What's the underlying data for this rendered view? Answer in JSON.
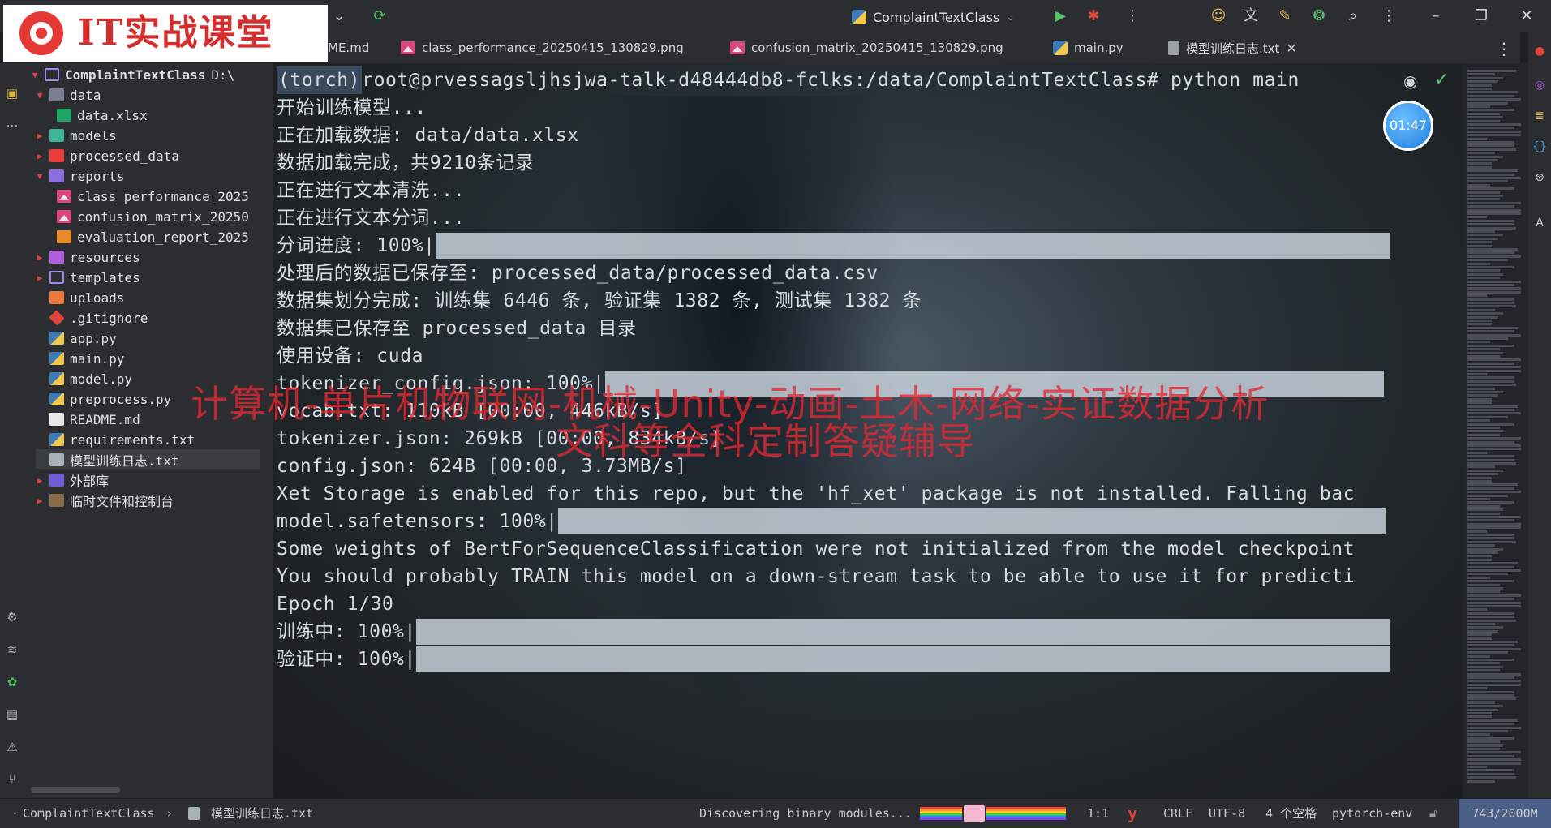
{
  "brand": {
    "text": "IT实战课堂"
  },
  "titlebar": {
    "project_name": "ComplaintTextClass"
  },
  "tabs": [
    {
      "label": "README.md",
      "visible_label": "ME.md",
      "icon": "markdown-icon"
    },
    {
      "label": "class_performance_20250415_130829.png",
      "icon": "image-icon"
    },
    {
      "label": "confusion_matrix_20250415_130829.png",
      "icon": "image-icon"
    },
    {
      "label": "main.py",
      "icon": "python-icon"
    },
    {
      "label": "模型训练日志.txt",
      "icon": "text-file-icon",
      "active": true
    }
  ],
  "project_tree": {
    "root_name": "ComplaintTextClass",
    "root_path": "D:\\",
    "items": [
      {
        "label": "data",
        "type": "folder"
      },
      {
        "label": "data.xlsx",
        "type": "xlsx"
      },
      {
        "label": "models",
        "type": "folder"
      },
      {
        "label": "processed_data",
        "type": "folder"
      },
      {
        "label": "reports",
        "type": "folder"
      },
      {
        "label": "class_performance_2025",
        "type": "image"
      },
      {
        "label": "confusion_matrix_20250",
        "type": "image"
      },
      {
        "label": "evaluation_report_2025",
        "type": "html"
      },
      {
        "label": "resources",
        "type": "folder"
      },
      {
        "label": "templates",
        "type": "folder"
      },
      {
        "label": "uploads",
        "type": "folder"
      },
      {
        "label": ".gitignore",
        "type": "git"
      },
      {
        "label": "app.py",
        "type": "python"
      },
      {
        "label": "main.py",
        "type": "python"
      },
      {
        "label": "model.py",
        "type": "python"
      },
      {
        "label": "preprocess.py",
        "type": "python"
      },
      {
        "label": "README.md",
        "type": "markdown"
      },
      {
        "label": "requirements.txt",
        "type": "python"
      },
      {
        "label": "模型训练日志.txt",
        "type": "text",
        "selected": true
      },
      {
        "label": "外部库",
        "type": "library"
      },
      {
        "label": "临时文件和控制台",
        "type": "scratch"
      }
    ]
  },
  "terminal": {
    "prompt_env": "(torch)",
    "prompt_rest": " root@prvessagsljhsjwa-talk-d48444db8-fclks:/data/ComplaintTextClass# python main",
    "lines": [
      "开始训练模型...",
      "正在加载数据: data/data.xlsx",
      "数据加载完成，共9210条记录",
      "正在进行文本清洗...",
      "正在进行文本分词...",
      "分词进度: 100%|",
      "处理后的数据已保存至: processed_data/processed_data.csv",
      "数据集划分完成: 训练集 6446 条, 验证集 1382 条, 测试集 1382 条",
      "数据集已保存至 processed_data 目录",
      "使用设备: cuda",
      "tokenizer_config.json: 100%|",
      "vocab.txt: 110kB [00:00, 446kB/s]",
      "tokenizer.json: 269kB [00:00, 834kB/s]",
      "config.json: 624B [00:00, 3.73MB/s]",
      "Xet Storage is enabled for this repo, but the 'hf_xet' package is not installed. Falling bac",
      "model.safetensors: 100%|",
      "Some weights of BertForSequenceClassification were not initialized from the model checkpoint",
      "You should probably TRAIN this model on a down-stream task to be able to use it for predicti",
      "Epoch 1/30",
      "训练中: 100%|",
      "验证中: 100%|"
    ],
    "progress": {
      "segmentation": 1.0,
      "tokenizer_config": 1.0,
      "model_safetensors": 1.0,
      "training": 1.0,
      "validation": 1.0
    },
    "timer": "01:47"
  },
  "watermark": {
    "line1": "计算机-单片机物联网-机械-Unity-动画-土木-网络-实证数据分析",
    "line2": "文科等全科定制答疑辅导"
  },
  "statusbar": {
    "breadcrumb_project": "ComplaintTextClass",
    "breadcrumb_file": "模型训练日志.txt",
    "task": "Discovering binary modules...",
    "position": "1:1",
    "line_ending": "CRLF",
    "encoding": "UTF-8",
    "indent": "4 个空格",
    "interpreter": "pytorch-env",
    "memory": "743/2000M"
  },
  "colors": {
    "accent": "#3574f0",
    "watermark": "#e62832",
    "brand_red": "#d32f2f"
  }
}
